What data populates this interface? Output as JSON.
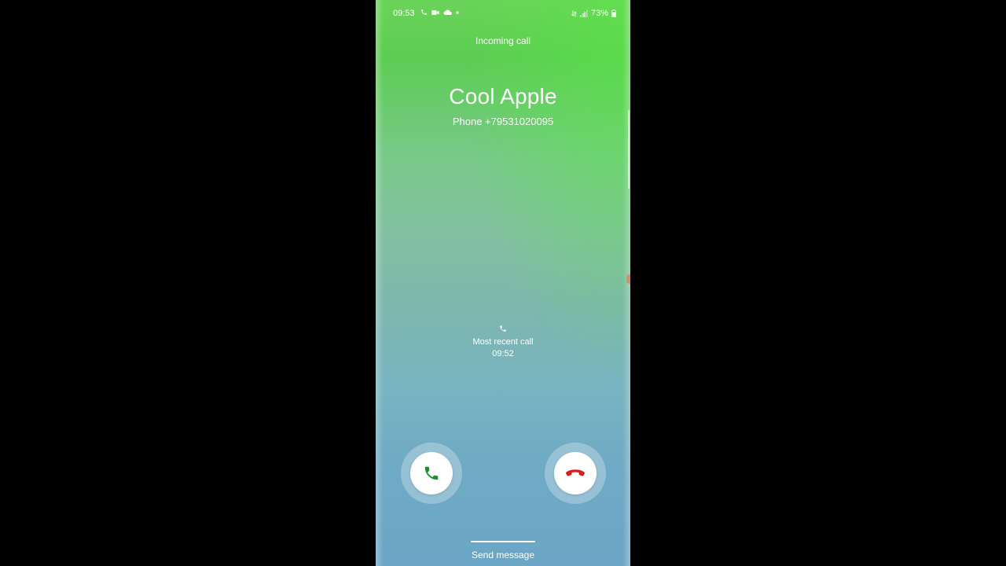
{
  "status_bar": {
    "time": "09:53",
    "battery": "73%",
    "left_icons": [
      "phone-icon",
      "video-camera-icon",
      "cloud-icon",
      "dot-icon"
    ],
    "right_icons": [
      "data-arrows-icon",
      "signal-icon",
      "battery-icon"
    ]
  },
  "call": {
    "state": "Incoming call",
    "caller_name": "Cool Apple",
    "number_label": "Phone",
    "number": "+79531020095",
    "recent_label": "Most recent call",
    "recent_time": "09:52"
  },
  "actions": {
    "accept_icon": "phone-accept-icon",
    "decline_icon": "phone-decline-icon",
    "send_message": "Send message"
  },
  "colors": {
    "accept": "#1a8f2e",
    "decline": "#d71f1f",
    "background_top": "#5ccc52",
    "background_bottom": "#6ba6c6"
  }
}
